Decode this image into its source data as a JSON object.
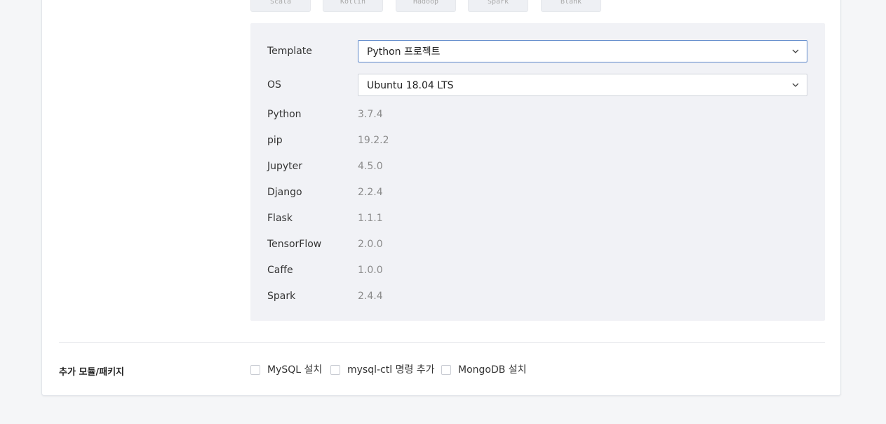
{
  "top_tabs": [
    "Scala",
    "Kotlin",
    "Hadoop",
    "Spark",
    "Blank"
  ],
  "config": {
    "template": {
      "label": "Template",
      "value": "Python 프로젝트"
    },
    "os": {
      "label": "OS",
      "value": "Ubuntu 18.04 LTS"
    },
    "versions": [
      {
        "name": "Python",
        "version": "3.7.4"
      },
      {
        "name": "pip",
        "version": "19.2.2"
      },
      {
        "name": "Jupyter",
        "version": "4.5.0"
      },
      {
        "name": "Django",
        "version": "2.2.4"
      },
      {
        "name": "Flask",
        "version": "1.1.1"
      },
      {
        "name": "TensorFlow",
        "version": "2.0.0"
      },
      {
        "name": "Caffe",
        "version": "1.0.0"
      },
      {
        "name": "Spark",
        "version": "2.4.4"
      }
    ]
  },
  "addons": {
    "label": "추가 모듈/패키지",
    "options": [
      {
        "label": "MySQL 설치",
        "checked": false
      },
      {
        "label": "mysql-ctl 명령 추가",
        "checked": false
      },
      {
        "label": "MongoDB 설치",
        "checked": false
      }
    ]
  },
  "icons": {
    "select_arrow": "chevron-down-icon",
    "checkbox": "checkbox-icon"
  }
}
